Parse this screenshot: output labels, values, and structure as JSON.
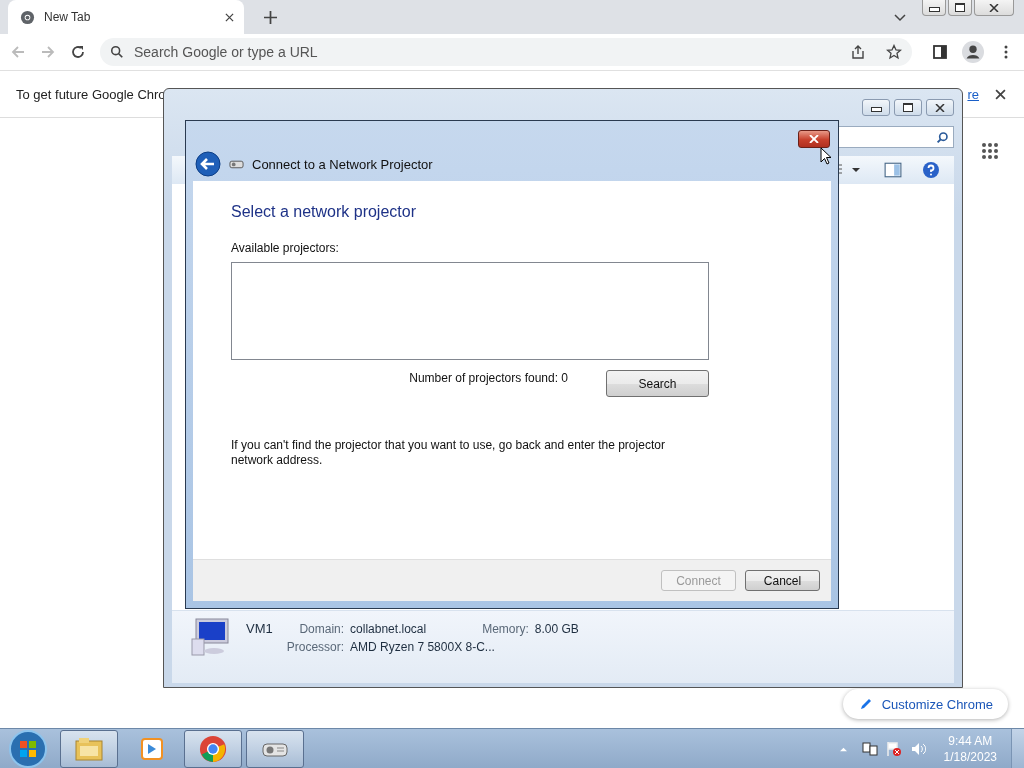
{
  "browser": {
    "tab": {
      "title": "New Tab",
      "selected": true
    },
    "omnibox": {
      "placeholder": "Search Google or type a URL"
    },
    "infobar": {
      "text": "To get future Google Chro",
      "link": "re"
    },
    "customize": "Customize Chrome"
  },
  "explorer": {
    "details": {
      "name": "VM1",
      "fields": [
        {
          "label": "Domain:",
          "value": "collabnet.local"
        },
        {
          "label": "Memory:",
          "value": "8.00 GB"
        },
        {
          "label": "Processor:",
          "value": "AMD Ryzen 7 5800X 8-C..."
        }
      ]
    }
  },
  "dialog": {
    "title": "Connect to a Network Projector",
    "heading": "Select a network projector",
    "list_label": "Available projectors:",
    "count": "Number of projectors found: 0",
    "search_button": "Search",
    "hint": "If you can't find the projector that you want to use, go back and enter the projector network address.",
    "buttons": [
      {
        "label": "Connect",
        "disabled": true
      },
      {
        "label": "Cancel",
        "disabled": false
      }
    ]
  },
  "taskbar": {
    "apps": [
      {
        "kind": "explorer",
        "open": true
      },
      {
        "kind": "media",
        "open": false
      },
      {
        "kind": "chrome",
        "open": true
      },
      {
        "kind": "projector",
        "open": true
      }
    ],
    "time": "9:44 AM",
    "date": "1/18/2023"
  }
}
